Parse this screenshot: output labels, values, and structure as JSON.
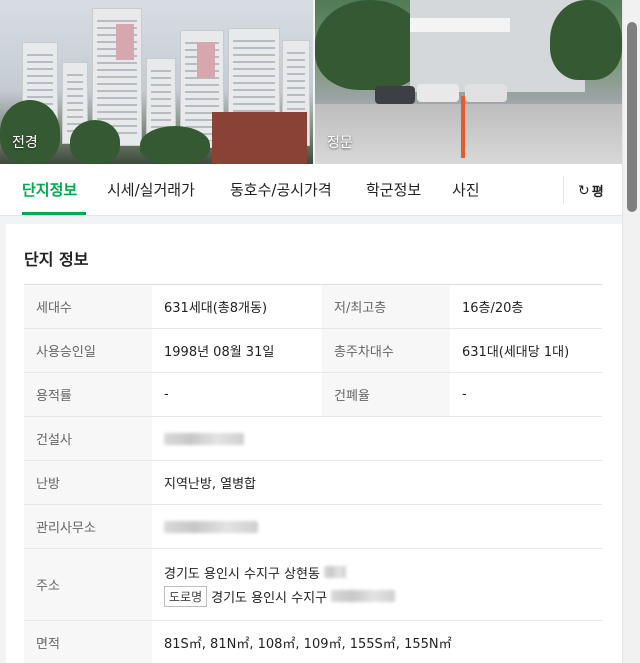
{
  "photos": [
    {
      "caption": "전경"
    },
    {
      "caption": "정문"
    }
  ],
  "tabs": [
    {
      "label": "단지정보",
      "active": true
    },
    {
      "label": "시세/실거래가",
      "active": false
    },
    {
      "label": "동호수/공시가격",
      "active": false
    },
    {
      "label": "학군정보",
      "active": false
    },
    {
      "label": "사진",
      "active": false
    }
  ],
  "tab_refresh": {
    "label": "평",
    "icon": "refresh-icon"
  },
  "accent_color": "#03a94e",
  "section_title": "단지 정보",
  "info": {
    "households_label": "세대수",
    "households_value": "631세대(총8개동)",
    "floors_label": "저/최고층",
    "floors_value": "16층/20층",
    "approval_label": "사용승인일",
    "approval_value": "1998년 08월 31일",
    "parking_label": "총주차대수",
    "parking_value": "631대(세대당 1대)",
    "far_label": "용적률",
    "far_value": "-",
    "bcr_label": "건폐율",
    "bcr_value": "-",
    "builder_label": "건설사",
    "heating_label": "난방",
    "heating_value": "지역난방, 열병합",
    "office_label": "관리사무소",
    "address_label": "주소",
    "address_lot": "경기도 용인시 수지구 상현동",
    "road_badge": "도로명",
    "address_road": "경기도 용인시 수지구",
    "area_label": "면적",
    "area_value": "81S㎡, 81N㎡, 108㎡, 109㎡, 155S㎡, 155N㎡"
  }
}
